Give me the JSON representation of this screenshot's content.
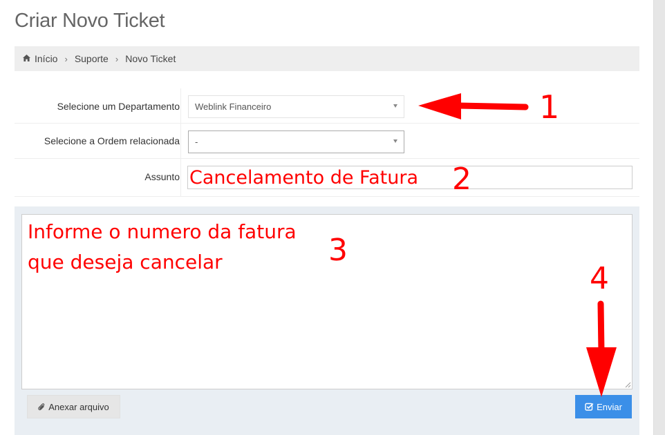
{
  "page": {
    "title": "Criar Novo Ticket"
  },
  "breadcrumb": {
    "items": [
      "Início",
      "Suporte",
      "Novo Ticket"
    ],
    "separator": "›"
  },
  "form": {
    "department_label": "Selecione um Departamento",
    "department_value": "Weblink Financeiro",
    "order_label": "Selecione a Ordem relacionada",
    "order_value": "-",
    "subject_label": "Assunto",
    "subject_value": "Cancelamento de Fatura",
    "message_value_line1": "Informe o numero da fatura",
    "message_value_line2": "que deseja cancelar"
  },
  "buttons": {
    "attach_label": "Anexar arquivo",
    "send_label": "Enviar"
  },
  "annotations": {
    "n1": "1",
    "n2": "2",
    "n3": "3",
    "n4": "4",
    "color": "#ff0000"
  },
  "colors": {
    "accent": "#3b8fe8",
    "panel": "#e9eef3",
    "breadcrumb_bg": "#eeeeee",
    "annotation": "#ff0000"
  },
  "icons": {
    "home": "home-icon",
    "paperclip": "paperclip-icon",
    "check": "check-square-icon"
  }
}
